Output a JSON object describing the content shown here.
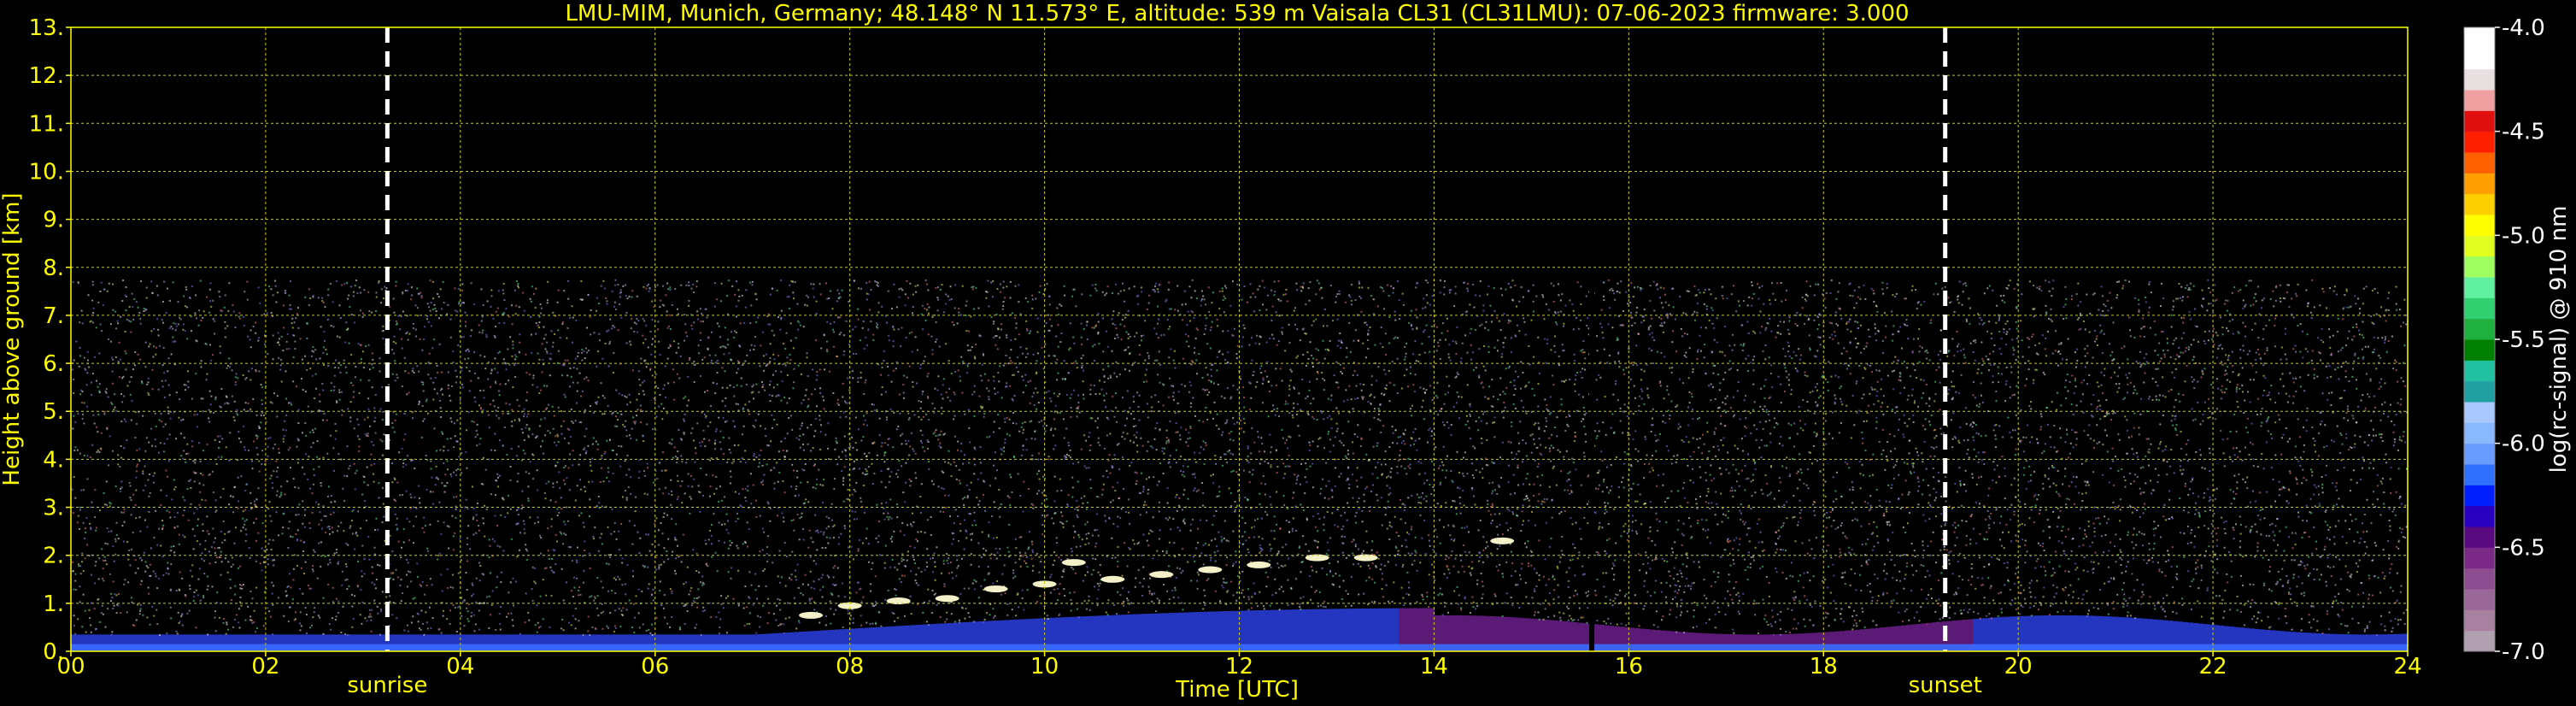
{
  "chart_data": {
    "type": "heatmap",
    "title": "LMU-MIM, Munich, Germany; 48.148° N 11.573° E, altitude: 539 m    Vaisala CL31 (CL31LMU): 07-06-2023    firmware: 3.000",
    "xlabel": "Time [UTC]",
    "ylabel": "Height above ground [km]",
    "xlim": [
      0,
      24
    ],
    "ylim": [
      0,
      13
    ],
    "x_ticks": [
      "00",
      "02",
      "04",
      "06",
      "08",
      "10",
      "12",
      "14",
      "16",
      "18",
      "20",
      "22",
      "24"
    ],
    "y_ticks": [
      "0.",
      "1.",
      "2.",
      "3.",
      "4.",
      "5.",
      "6.",
      "7.",
      "8.",
      "9.",
      "10.",
      "11.",
      "12.",
      "13."
    ],
    "grid": true,
    "data_top_height_km": 7.75,
    "sunrise_time_utc": 3.25,
    "sunset_time_utc": 19.25,
    "sunrise_label": "sunrise",
    "sunset_label": "sunset",
    "missing_data_time_utc": 15.62,
    "cloud_layer_points": [
      {
        "x": 7.6,
        "y": 0.75
      },
      {
        "x": 8.0,
        "y": 0.95
      },
      {
        "x": 8.5,
        "y": 1.05
      },
      {
        "x": 9.0,
        "y": 1.1
      },
      {
        "x": 9.5,
        "y": 1.3
      },
      {
        "x": 10.0,
        "y": 1.4
      },
      {
        "x": 10.3,
        "y": 1.85
      },
      {
        "x": 10.7,
        "y": 1.5
      },
      {
        "x": 11.2,
        "y": 1.6
      },
      {
        "x": 11.7,
        "y": 1.7
      },
      {
        "x": 12.2,
        "y": 1.8
      },
      {
        "x": 12.8,
        "y": 1.95
      },
      {
        "x": 13.3,
        "y": 1.95
      },
      {
        "x": 14.7,
        "y": 2.3
      }
    ],
    "colorbar": {
      "label": "log(rc-signal) @ 910 nm",
      "ticks": [
        "-4.0",
        "-4.5",
        "-5.0",
        "-5.5",
        "-6.0",
        "-6.5",
        "-7.0"
      ],
      "range": [
        -7.0,
        -4.0
      ],
      "colors": [
        "#b0a0b0",
        "#a880a0",
        "#9a6898",
        "#8c4c90",
        "#7a2a86",
        "#5a0a80",
        "#2a00c0",
        "#0020ff",
        "#3070ff",
        "#6a9cff",
        "#8ab8ff",
        "#a8c8ff",
        "#20a0a0",
        "#20c0a0",
        "#008000",
        "#20b040",
        "#30d070",
        "#60f0a0",
        "#a0ff60",
        "#e0ff20",
        "#ffff00",
        "#ffd000",
        "#ffa000",
        "#ff6000",
        "#ff2000",
        "#e01010",
        "#f0a0a0",
        "#e8e0e0",
        "#ffffff",
        "#ffffff"
      ]
    }
  }
}
